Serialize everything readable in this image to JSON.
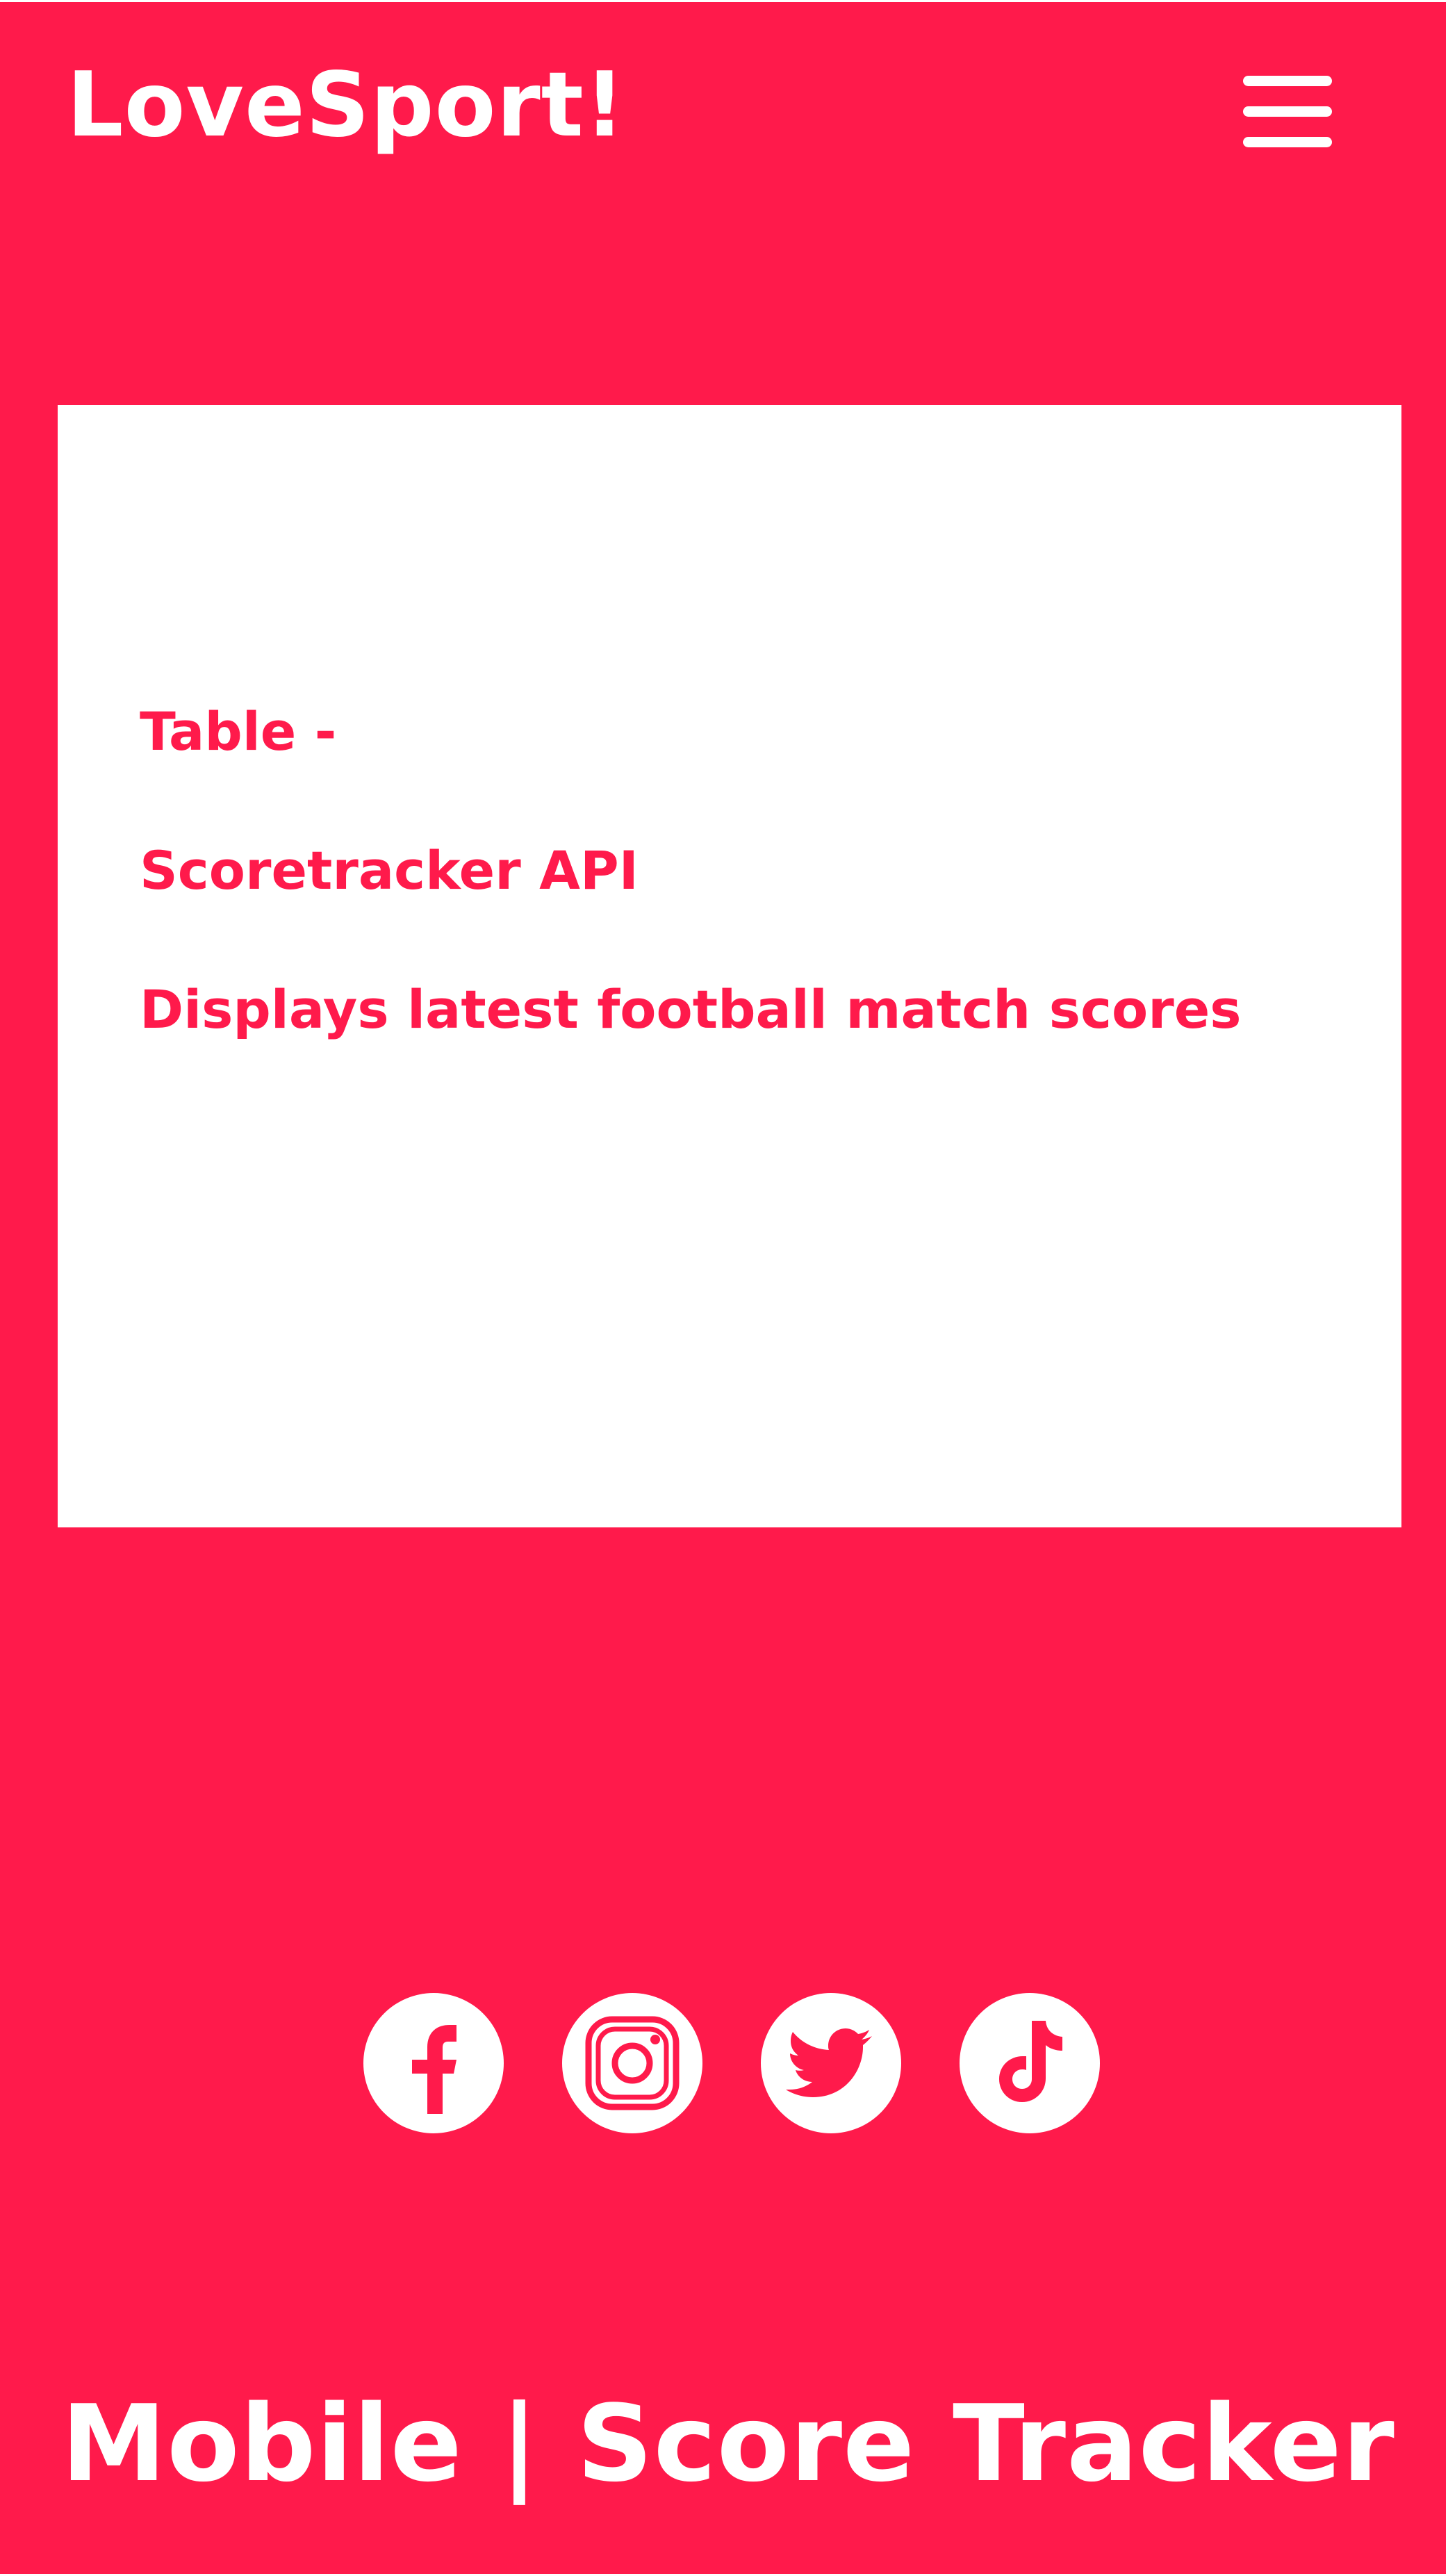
{
  "header": {
    "brand": "LoveSport!",
    "menu_icon": "hamburger-menu-icon"
  },
  "card": {
    "lines": [
      "Table -",
      "Scoretracker API",
      "Displays latest football match scores"
    ]
  },
  "socials": [
    {
      "icon": "facebook-icon"
    },
    {
      "icon": "instagram-icon"
    },
    {
      "icon": "twitter-icon"
    },
    {
      "icon": "tiktok-icon"
    }
  ],
  "footer": {
    "title": "Mobile | Score Tracker"
  },
  "colors": {
    "background": "#ff1a4b",
    "foreground": "#ffffff",
    "accent_text": "#ff1a4b"
  }
}
